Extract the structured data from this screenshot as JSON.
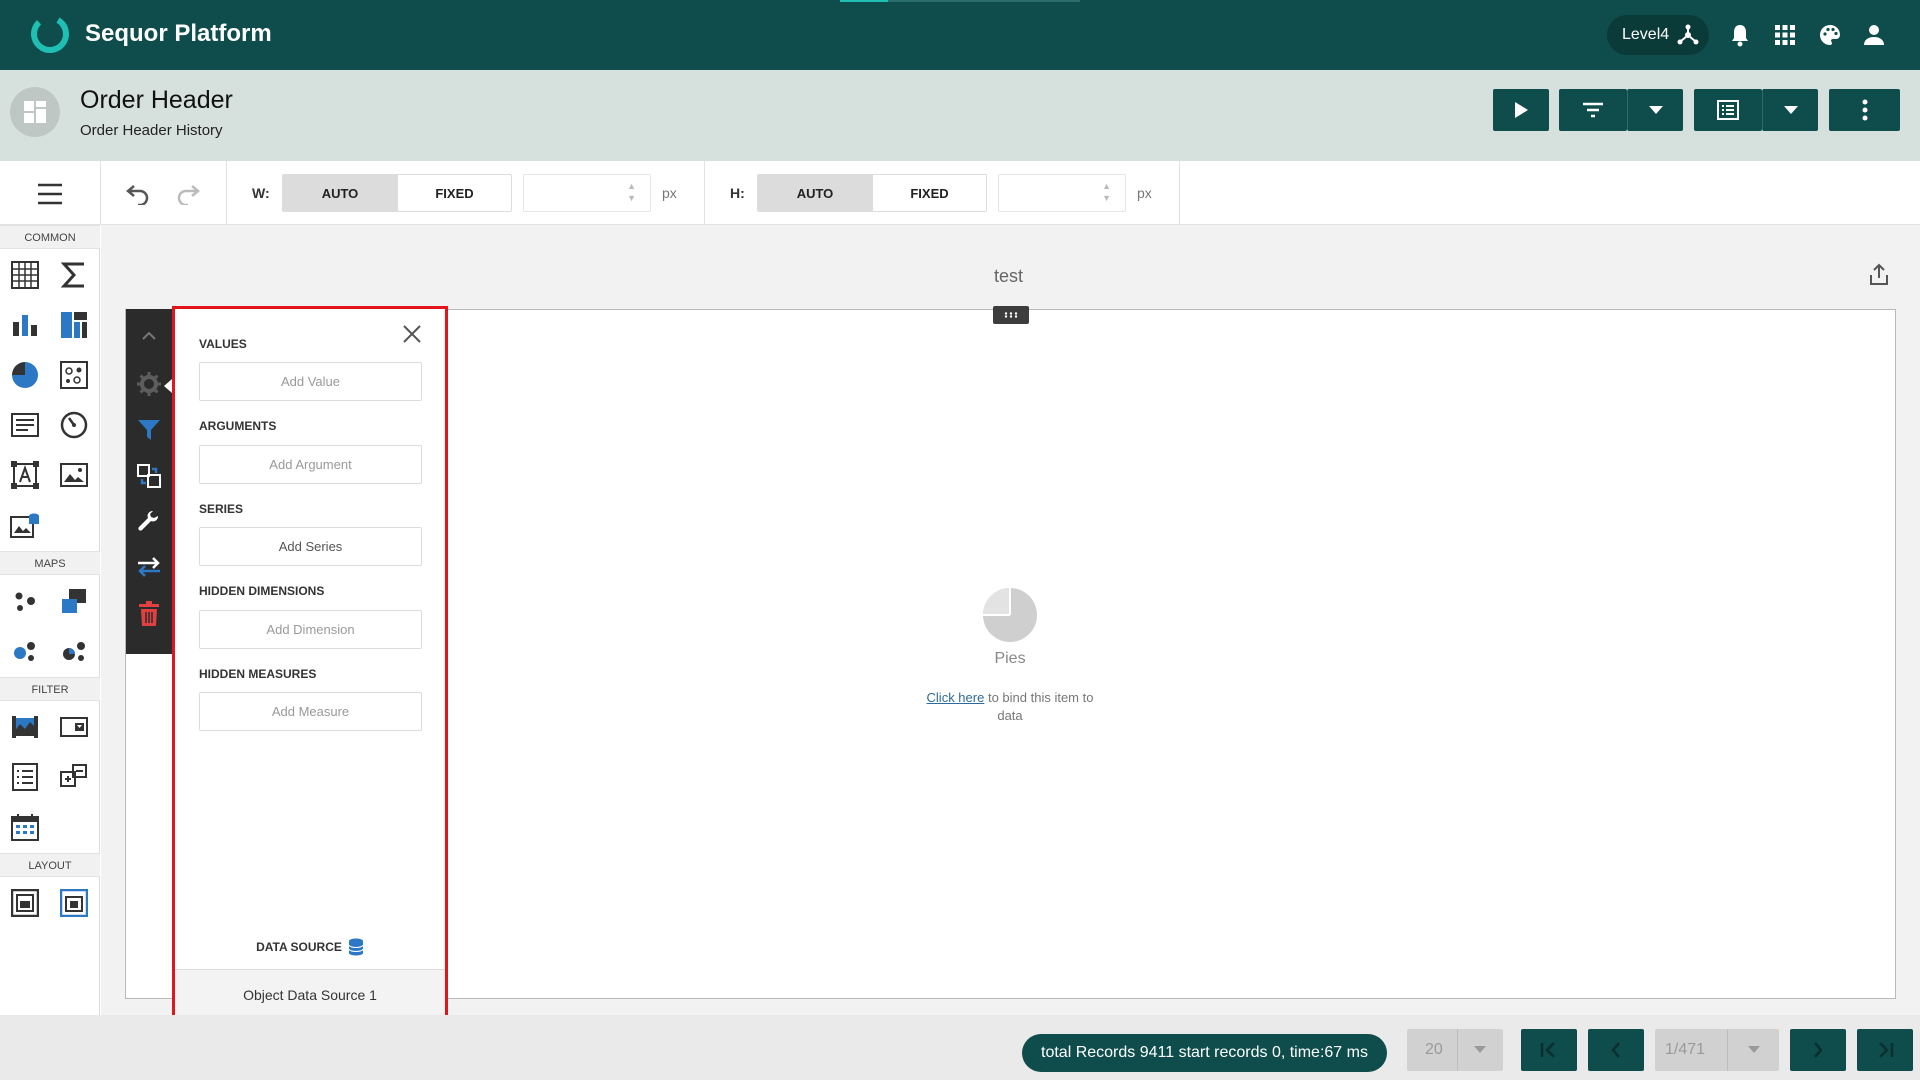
{
  "app": {
    "title": "Sequor Platform",
    "level": "Level4"
  },
  "colors": {
    "brand": "#0e4d4b",
    "accent": "#1fbfb4",
    "highlight": "#e3141a",
    "link": "#2d6b9a"
  },
  "top_icons": [
    "hierarchy-icon",
    "bell-icon",
    "apps-grid-icon",
    "palette-icon",
    "user-icon"
  ],
  "header": {
    "title": "Order Header",
    "subtitle": "Order Header History"
  },
  "toolbar": {
    "width_label": "W:",
    "height_label": "H:",
    "auto_label": "AUTO",
    "fixed_label": "FIXED",
    "unit": "px",
    "width_value": "",
    "height_value": ""
  },
  "left_panel": {
    "sections": [
      "COMMON",
      "MAPS",
      "FILTER",
      "LAYOUT"
    ]
  },
  "dashboard": {
    "item_title": "test",
    "placeholder_label": "Pies",
    "bind_link": "Click here",
    "bind_text": "to bind this item to data"
  },
  "bindings": {
    "values_label": "VALUES",
    "add_value": "Add Value",
    "arguments_label": "ARGUMENTS",
    "add_argument": "Add Argument",
    "series_label": "SERIES",
    "add_series": "Add Series",
    "hidden_dimensions_label": "HIDDEN DIMENSIONS",
    "add_dimension": "Add Dimension",
    "hidden_measures_label": "HIDDEN MEASURES",
    "add_measure": "Add Measure",
    "data_source_label": "DATA SOURCE",
    "data_source_name": "Object Data Source 1"
  },
  "footer": {
    "status": "total Records 9411 start records 0, time:67 ms",
    "page_size": "20",
    "page_indicator": "1/471"
  }
}
